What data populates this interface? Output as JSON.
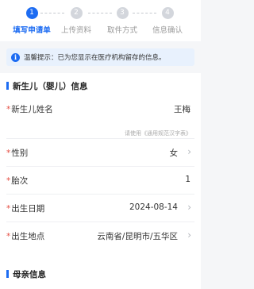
{
  "steps": [
    {
      "num": "1",
      "label": "填写申请单"
    },
    {
      "num": "2",
      "label": "上传资料"
    },
    {
      "num": "3",
      "label": "取件方式"
    },
    {
      "num": "4",
      "label": "信息确认"
    }
  ],
  "tip": {
    "text": "温馨提示：已为您显示在医疗机构留存的信息。"
  },
  "newborn": {
    "title": "新生儿（婴儿）信息",
    "name_label": "新生儿姓名",
    "name_value": "王梅",
    "name_hint": "请使用《通用规范汉字表》",
    "gender_label": "性别",
    "gender_value": "女",
    "parity_label": "胎次",
    "parity_value": "1",
    "birthdate_label": "出生日期",
    "birthdate_value": "2024-08-14",
    "birthplace_label": "出生地点",
    "birthplace_value": "云南省/昆明市/五华区",
    "required_mark": "*"
  },
  "mother": {
    "title": "母亲信息"
  },
  "colors": {
    "accent": "#1d6cf2",
    "required": "#e54d42"
  }
}
